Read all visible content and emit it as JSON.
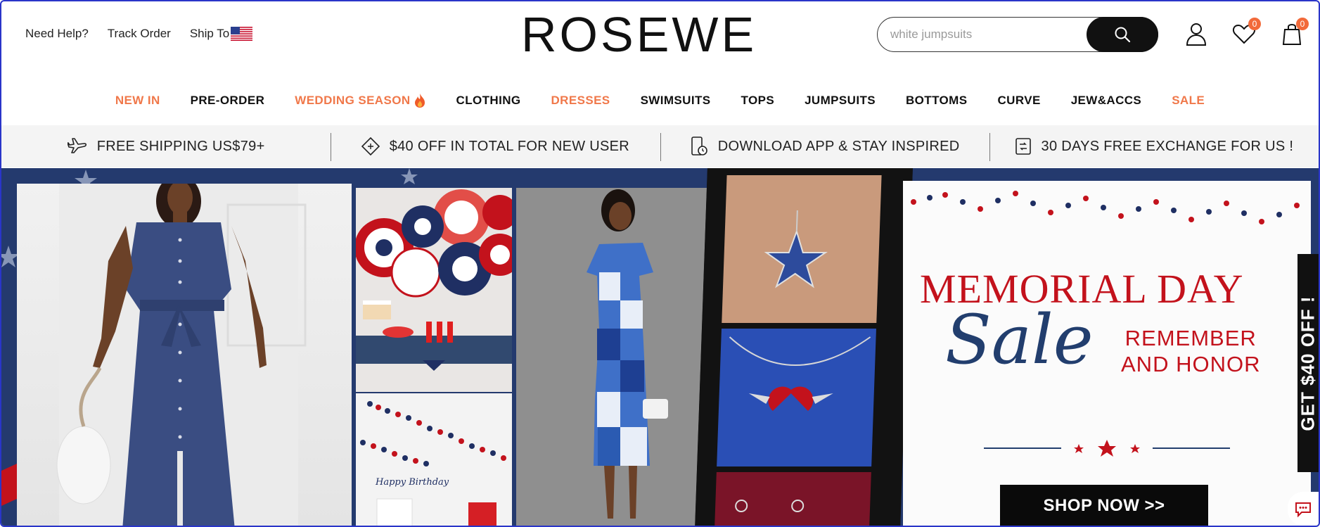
{
  "header": {
    "links": [
      "Need Help?",
      "Track Order",
      "Ship To"
    ],
    "logo": "ROSEWE",
    "search_placeholder": "white jumpsuits",
    "wishlist_count": "0",
    "cart_count": "0"
  },
  "nav": [
    {
      "label": "NEW IN",
      "accent": true
    },
    {
      "label": "PRE-ORDER",
      "accent": false
    },
    {
      "label": "WEDDING SEASON",
      "accent": true
    },
    {
      "label": "CLOTHING",
      "accent": false
    },
    {
      "label": "DRESSES",
      "accent": true
    },
    {
      "label": "SWIMSUITS",
      "accent": false
    },
    {
      "label": "TOPS",
      "accent": false
    },
    {
      "label": "JUMPSUITS",
      "accent": false
    },
    {
      "label": "BOTTOMS",
      "accent": false
    },
    {
      "label": "CURVE",
      "accent": false
    },
    {
      "label": "JEW&ACCS",
      "accent": false
    },
    {
      "label": "SALE",
      "accent": true
    }
  ],
  "promo": [
    {
      "icon": "plane-icon",
      "text": "FREE SHIPPING US$79+"
    },
    {
      "icon": "coupon-icon",
      "text": "$40 OFF IN TOTAL FOR NEW USER"
    },
    {
      "icon": "phone-icon",
      "text": "DOWNLOAD APP & STAY INSPIRED"
    },
    {
      "icon": "exchange-icon",
      "text": "30 DAYS FREE EXCHANGE FOR US !"
    }
  ],
  "banner": {
    "title": "MEMORIAL DAY",
    "sale": "Sale",
    "remember_line1": "REMEMBER",
    "remember_line2": "AND HONOR",
    "cta": "SHOP NOW >>",
    "side_tab": "GET $40 OFF !",
    "birthday_text": "Happy Birthday"
  },
  "colors": {
    "accent": "#f0784a",
    "red": "#c3121c",
    "navy": "#223e6e"
  }
}
